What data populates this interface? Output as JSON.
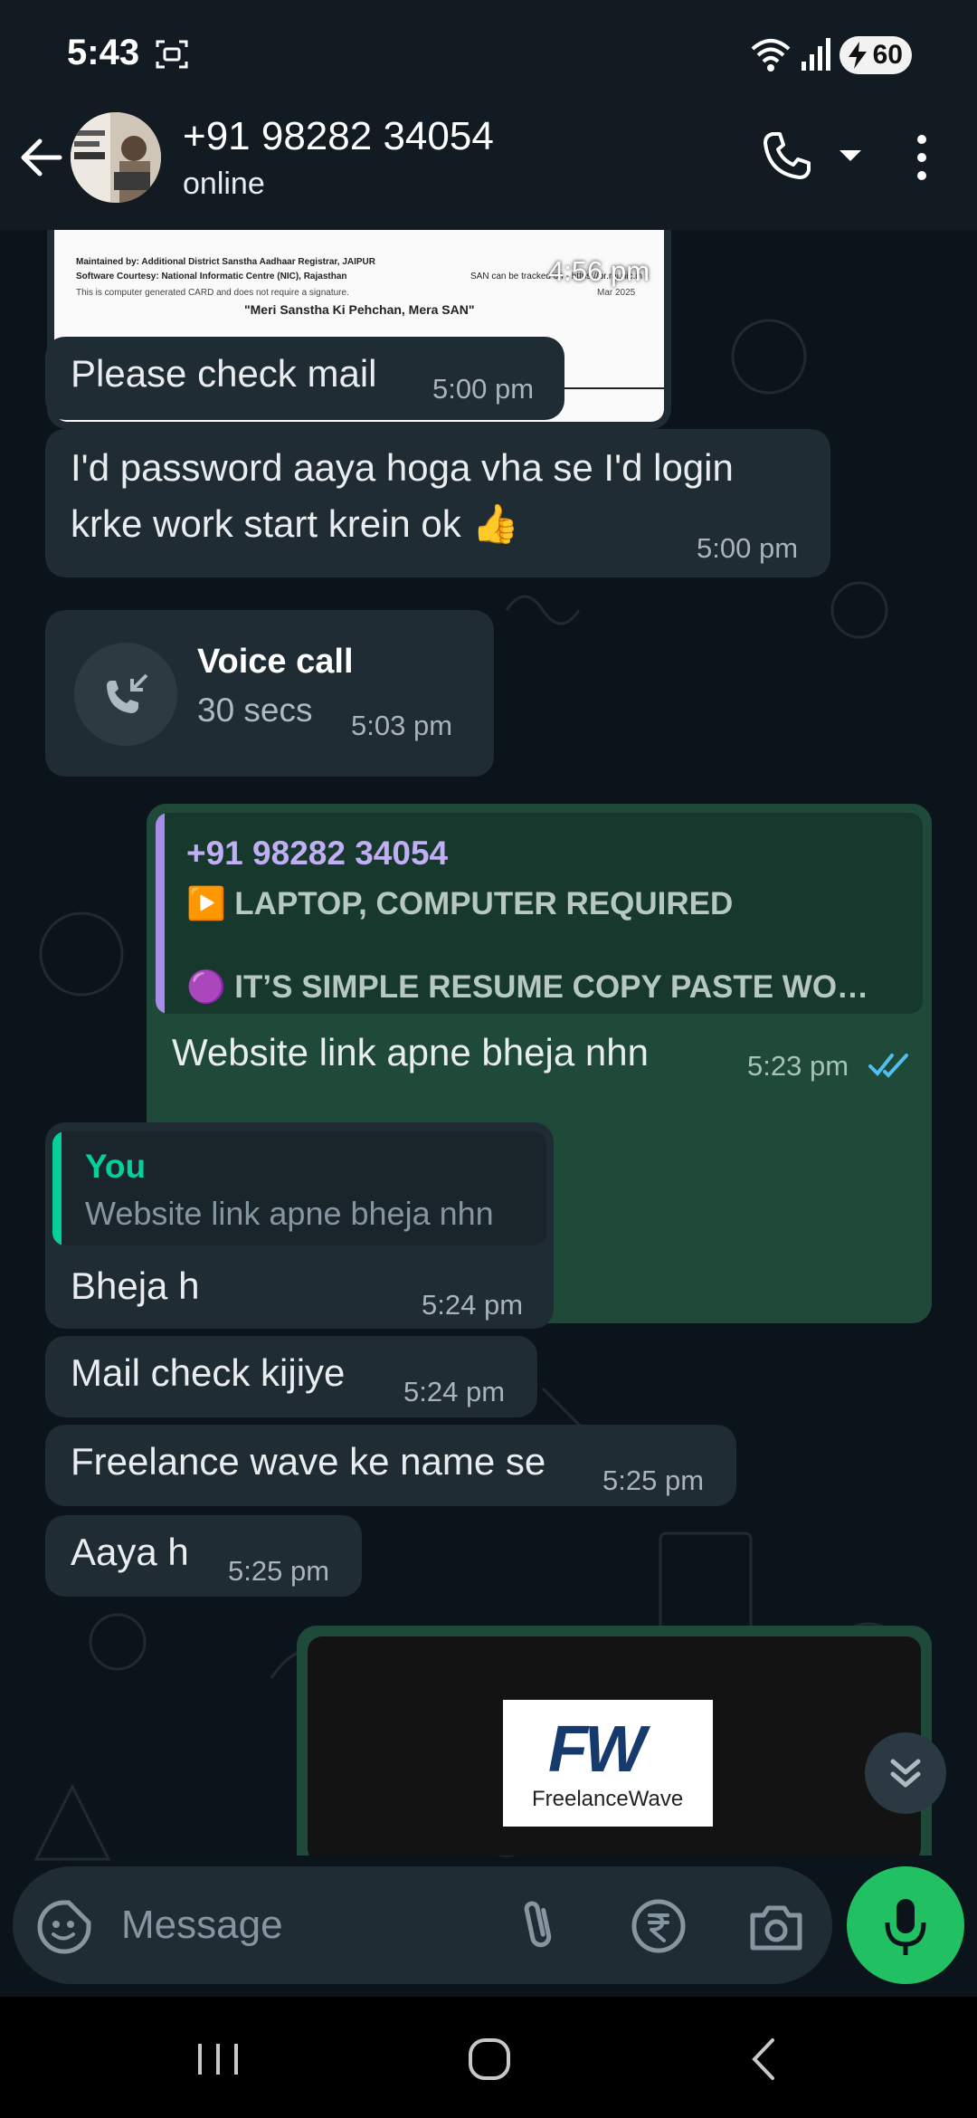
{
  "status_bar": {
    "time": "5:43",
    "battery": "60"
  },
  "header": {
    "contact_name": "+91 98282 34054",
    "contact_status": "online"
  },
  "messages": {
    "card_time": "4:56 pm",
    "card_lines": {
      "maintained": "Maintained by: Additional District Sanstha Aadhaar Registrar, JAIPUR",
      "courtesy": "Software Courtesy: National Informatic Centre (NIC), Rajasthan",
      "tracked": "SAN can be tracked on - https://br.raj.nic.in",
      "note": "This is computer generated CARD and does not require a signature.",
      "date": "Mar 2025",
      "slogan": "\"Meri Sanstha Ki Pehchan, Mera SAN\""
    },
    "m1": {
      "text": "Please check mail",
      "time": "5:00 pm"
    },
    "m2": {
      "line1": "I'd password aaya hoga vha se I'd login",
      "line2": "krke work start krein ok 👍",
      "time": "5:00 pm"
    },
    "call": {
      "title": "Voice call",
      "duration": "30 secs",
      "time": "5:03 pm"
    },
    "m3": {
      "quote_author": "+91 98282 34054",
      "quote_line1": "▶️ LAPTOP, COMPUTER REQUIRED",
      "quote_line2": "🟣 IT’S SIMPLE RESUME COPY PASTE WO…",
      "text": "Website link apne bheja nhn",
      "time": "5:23 pm"
    },
    "m4": {
      "quote_author": "You",
      "quote_text": "Website link apne bheja nhn",
      "text": "Bheja h",
      "time": "5:24 pm"
    },
    "m5": {
      "text": "Mail check kijiye",
      "time": "5:24 pm"
    },
    "m6": {
      "text": "Freelance wave ke name se",
      "time": "5:25 pm"
    },
    "m7": {
      "text": "Aaya h",
      "time": "5:25 pm"
    },
    "preview": {
      "logo_letters": "FW",
      "logo_name": "FreelanceWave"
    }
  },
  "composer": {
    "placeholder": "Message"
  },
  "colors": {
    "accent": "#21c063",
    "outgoing_bubble": "#1f4a3a",
    "incoming_bubble": "#202c33",
    "read_ticks": "#53bdeb"
  }
}
